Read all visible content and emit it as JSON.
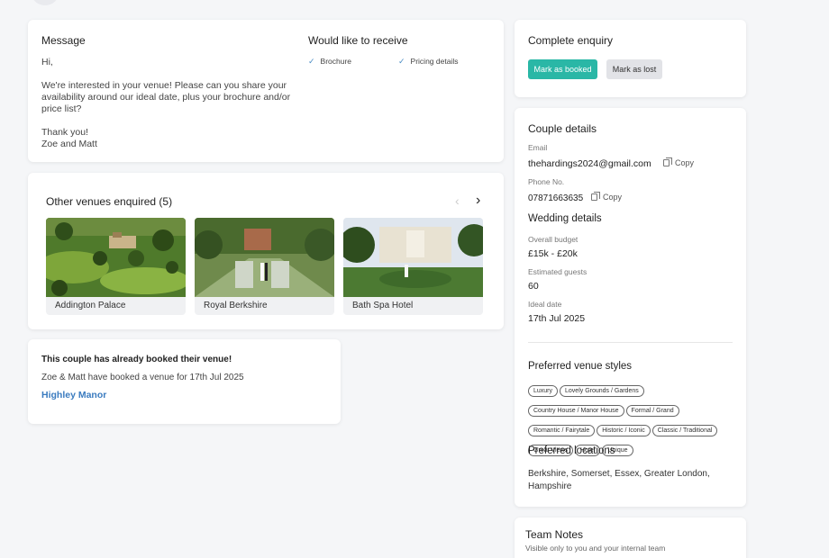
{
  "message": {
    "title": "Message",
    "lines": [
      "Hi,",
      "We're interested in your venue! Please can you share your availability around our ideal date, plus your brochure and/or price list?",
      "Thank you!",
      "Zoe and Matt"
    ],
    "receive_title": "Would like to receive",
    "receive_items": [
      "Brochure",
      "Pricing details"
    ]
  },
  "other_venues": {
    "title": "Other venues enquired (5)",
    "items": [
      {
        "name": "Addington Palace"
      },
      {
        "name": "Royal Berkshire"
      },
      {
        "name": "Bath Spa Hotel"
      }
    ]
  },
  "booked": {
    "title": "This couple has already booked their venue!",
    "text": "Zoe & Matt have booked a venue for 17th Jul 2025",
    "venue_link": "Highley Manor"
  },
  "complete": {
    "title": "Complete enquiry",
    "booked_label": "Mark as booked",
    "lost_label": "Mark as lost"
  },
  "couple": {
    "title": "Couple details",
    "email_label": "Email",
    "email": "thehardings2024@gmail.com",
    "phone_label": "Phone No.",
    "phone": "07871663635",
    "copy_label": "Copy"
  },
  "wedding": {
    "title": "Wedding details",
    "budget_label": "Overall budget",
    "budget": "£15k - £20k",
    "guests_label": "Estimated guests",
    "guests": "60",
    "date_label": "Ideal date",
    "date": "17th Jul 2025"
  },
  "styles": {
    "title": "Preferred venue styles",
    "tags": [
      "Luxury",
      "Lovely Grounds / Gardens",
      "Country House / Manor House",
      "Formal / Grand",
      "Romantic / Fairytale",
      "Historic / Iconic",
      "Classic / Traditional",
      "Great Views",
      "Hotel",
      "Unique"
    ]
  },
  "locations": {
    "title": "Preferred locations",
    "text": "Berkshire, Somerset, Essex, Greater London, Hampshire"
  },
  "team_notes": {
    "title": "Team Notes",
    "subtitle": "Visible only to you and your internal team"
  },
  "colors": {
    "accent": "#2ab7a6",
    "link": "#3a7bbf",
    "check": "#4a8cc4"
  }
}
